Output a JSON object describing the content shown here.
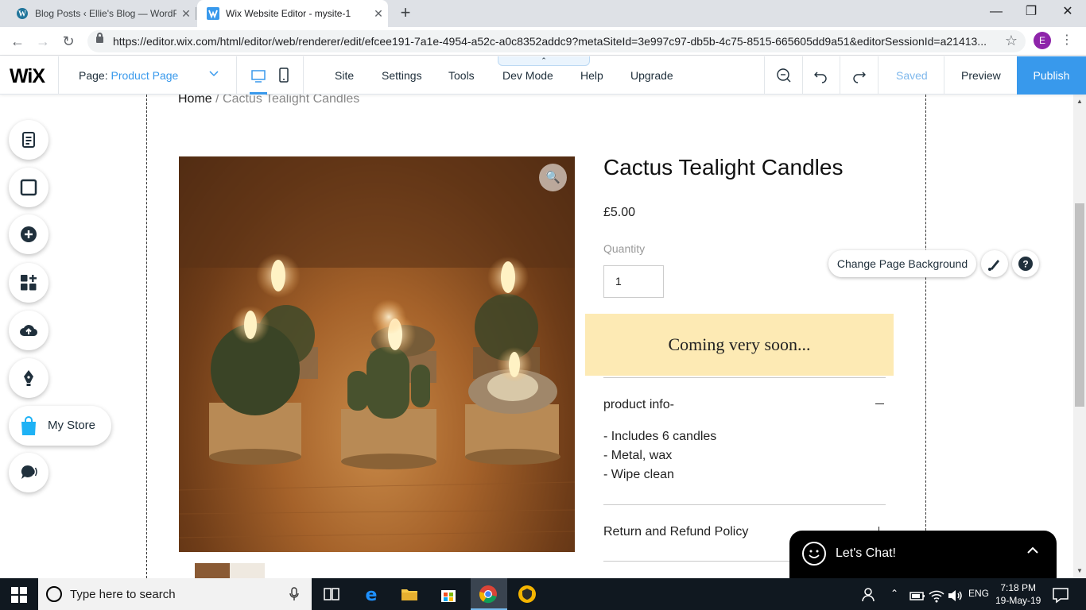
{
  "browser": {
    "tabs": [
      {
        "title": "Blog Posts ‹ Ellie's Blog — WordPress",
        "icon": "wordpress-icon"
      },
      {
        "title": "Wix Website Editor - mysite-1",
        "icon": "wix-icon",
        "active": true
      }
    ],
    "url": "https://editor.wix.com/html/editor/web/renderer/edit/efcee191-7a1e-4954-a52c-a0c8352addc9?metaSiteId=3e997c97-db5b-4c75-8515-665605dd9a51&editorSessionId=a21413...",
    "profile_initial": "E"
  },
  "editor": {
    "logo": "WiX",
    "page_label": "Page:",
    "page_value": "Product Page",
    "menu": [
      "Site",
      "Settings",
      "Tools",
      "Dev Mode",
      "Help",
      "Upgrade"
    ],
    "saved": "Saved",
    "preview": "Preview",
    "publish": "Publish",
    "accent_color": "#3899ec"
  },
  "left_panel": {
    "my_store": "My Store"
  },
  "product": {
    "breadcrumb_home": "Home",
    "breadcrumb_sep": " / ",
    "breadcrumb_current": "Cactus Tealight Candles",
    "title": "Cactus Tealight Candles",
    "price": "£5.00",
    "quantity_label": "Quantity",
    "quantity_value": "1",
    "coming_soon": "Coming very soon...",
    "coming_soon_bg": "#fdeab4",
    "info_title": "product info-",
    "info_lines": [
      "- Includes 6 candles",
      "- Metal, wax",
      "- Wipe clean"
    ],
    "refund_title": "Return and Refund Policy"
  },
  "overlays": {
    "change_bg": "Change Page Background",
    "chat_label": "Let's Chat!"
  },
  "taskbar": {
    "search_placeholder": "Type here to search",
    "lang": "ENG",
    "time": "7:18 PM",
    "date": "19-May-19"
  }
}
